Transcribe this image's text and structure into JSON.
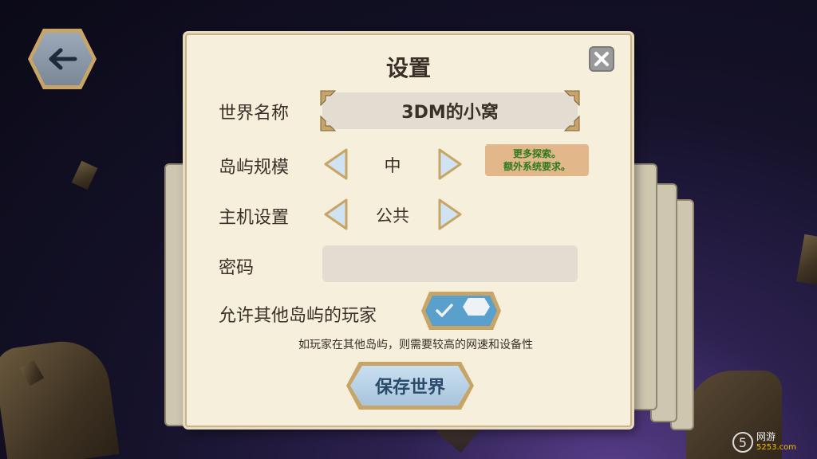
{
  "title": "设置",
  "rows": {
    "world_name": {
      "label": "世界名称",
      "value": "3DM的小窝"
    },
    "island_size": {
      "label": "岛屿规模",
      "value": "中"
    },
    "host_setting": {
      "label": "主机设置",
      "value": "公共"
    },
    "password": {
      "label": "密码",
      "value": ""
    },
    "allow_islands": {
      "label": "允许其他岛屿的玩家",
      "enabled": true
    }
  },
  "note": {
    "line1": "更多探索。",
    "line2": "额外系统要求。"
  },
  "hint": "如玩家在其他岛屿，则需要较高的网速和设备性",
  "save_label": "保存世界",
  "watermark": {
    "number": "5",
    "text": "网游",
    "sub": "5253.com"
  },
  "colors": {
    "accent": "#5aa0cc",
    "frame": "#c8a566",
    "note_text": "#2f7a1e"
  }
}
